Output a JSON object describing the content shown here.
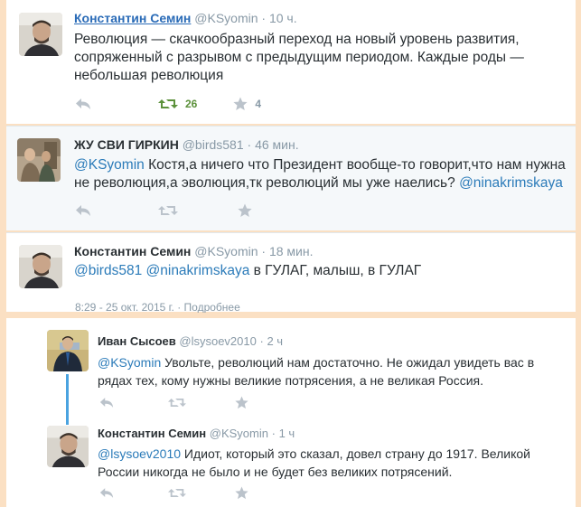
{
  "tweets": [
    {
      "name": "Константин Семин",
      "handle": "@KSyomin",
      "sep": "·",
      "time": "10 ч.",
      "text": "Революция — скачкообразный переход на новый уровень развития, сопряженный с разрывом с предыдущим периодом. Каждые роды — небольшая революция",
      "retweets": "26",
      "favorites": "4"
    },
    {
      "name": "ЖУ СВИ ГИРКИН",
      "handle": "@birds581",
      "sep": "·",
      "time": "46 мин.",
      "mention1": "@KSyomin",
      "text": " Костя,а ничего что Президент вообще-то говорит,что нам нужна не революция,а эволюция,тк революций мы уже наелись? ",
      "mention2": "@ninakrimskaya"
    },
    {
      "name": "Константин Семин",
      "handle": "@KSyomin",
      "sep": "·",
      "time": "18 мин.",
      "mention1": "@birds581",
      "mention2": "@ninakrimskaya",
      "text": " в ГУЛАГ, малыш, в ГУЛАГ",
      "meta": "8:29 - 25 окт. 2015 г. · Подробнее"
    }
  ],
  "conversation": [
    {
      "name": "Иван Сысоев",
      "handle": "@lsysoev2010",
      "sep": "·",
      "time": "2 ч",
      "mention": "@KSyomin",
      "text": " Увольте, революций нам достаточно. Не ожидал увидеть вас в рядах тех, кому нужны великие потрясения, а не великая Россия."
    },
    {
      "name": "Константин Семин",
      "handle": "@KSyomin",
      "sep": "·",
      "time": "1 ч",
      "mention": "@lsysoev2010",
      "text": " Идиот, который это сказал, довел страну до 1917. Великой России никогда не было и не будет без великих потрясений."
    }
  ],
  "icons": [
    "reply-icon",
    "retweet-icon",
    "favorite-icon"
  ],
  "colors": {
    "background": "#fbe0c3",
    "link": "#2b7bb9",
    "retweet_active": "#5c913b",
    "icon_grey": "#bbc3cb",
    "thread_line": "#4aa3e0"
  }
}
